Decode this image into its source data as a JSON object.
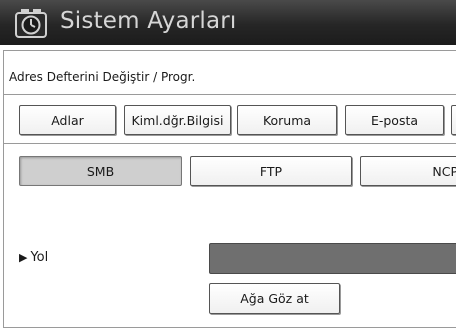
{
  "header": {
    "title": "Sistem Ayarları",
    "icon": "settings-clock-icon"
  },
  "breadcrumb": "Adres Defterini Değiştir / Progr.",
  "tabs": [
    {
      "label": "Adlar",
      "selected": false
    },
    {
      "label": "Kiml.dğr.Bilgisi",
      "selected": false
    },
    {
      "label": "Koruma",
      "selected": false
    },
    {
      "label": "E-posta",
      "selected": false
    }
  ],
  "protocols": [
    {
      "label": "SMB",
      "selected": true
    },
    {
      "label": "FTP",
      "selected": false
    },
    {
      "label": "NCP",
      "selected": false
    }
  ],
  "path": {
    "label": "Yol",
    "value": ""
  },
  "browse_button": "Ağa Göz at",
  "colors": {
    "header_bg": "#262626",
    "title_text": "#d6d6d6",
    "selected_btn": "#cfcfcf",
    "path_field": "#6f6f6f"
  }
}
